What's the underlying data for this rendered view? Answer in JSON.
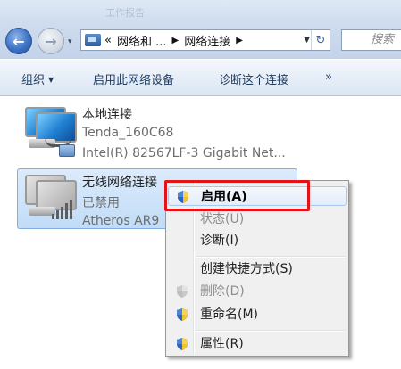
{
  "title_bar": {
    "ghost_text": "工作报告"
  },
  "nav": {
    "back": "←",
    "forward": "→",
    "recent": "▾"
  },
  "address": {
    "chevron_left": "«",
    "segment1": "网络和 ...",
    "sep1": "▶",
    "segment2": "网络连接",
    "sep2": "▶",
    "dropdown": "▼",
    "refresh": "↻"
  },
  "search": {
    "placeholder": "搜索"
  },
  "toolbar": {
    "organize": "组织",
    "organize_caret": "▼",
    "enable_device": "启用此网络设备",
    "diagnose": "诊断这个连接",
    "more": "»"
  },
  "connections": [
    {
      "name": "本地连接",
      "line2": "Tenda_160C68",
      "line3": "Intel(R) 82567LF-3 Gigabit Net..."
    },
    {
      "name": "无线网络连接",
      "line2": "已禁用",
      "line3": "Atheros AR9"
    }
  ],
  "context_menu": {
    "items": [
      {
        "label": "启用(A)",
        "icon": "shield-icon"
      },
      {
        "label": "状态(U)"
      },
      {
        "label": "诊断(I)"
      },
      {
        "label": "创建快捷方式(S)"
      },
      {
        "label": "删除(D)",
        "icon": "shield-icon-disabled"
      },
      {
        "label": "重命名(M)",
        "icon": "shield-icon"
      },
      {
        "label": "属性(R)",
        "icon": "shield-icon"
      }
    ]
  },
  "colors": {
    "highlight": "#e4131a",
    "toolbar_text": "#1e395b",
    "selection": "#c1dcf7"
  }
}
